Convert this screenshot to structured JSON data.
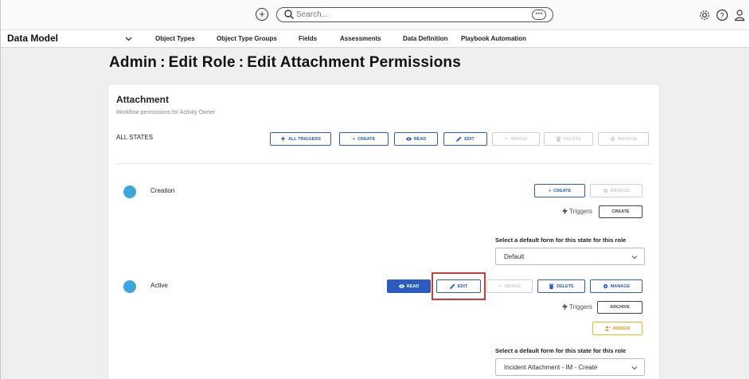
{
  "topbar": {
    "search_placeholder": "Search...",
    "more_label": "•••",
    "add_icon": "plus-circle-icon",
    "icons": [
      "gear-icon",
      "help-icon",
      "user-icon"
    ]
  },
  "nav": {
    "title": "Data Model",
    "items": [
      "Object Types",
      "Object Type Groups",
      "Fields",
      "Assessments",
      "Data Definition",
      "Playbook Automation"
    ]
  },
  "page_title": "Admin : Edit Role : Edit Attachment Permissions",
  "card": {
    "title": "Attachment",
    "subtitle": "Workflow permissions for Activity Owner",
    "all_states_label": "ALL STATES",
    "all_states_buttons": [
      "ALL TRIGGERS",
      "CREATE",
      "READ",
      "EDIT",
      "MERGE",
      "DELETE",
      "MANAGE"
    ]
  },
  "states": {
    "creation": {
      "name": "Creation",
      "buttons": [
        "CREATE",
        "MANAGE"
      ],
      "triggers_label": "Triggers",
      "trigger_button": "CREATE",
      "form_label": "Select a default form for this state for this role",
      "form_value": "Default"
    },
    "active": {
      "name": "Active",
      "buttons": [
        "READ",
        "EDIT",
        "MERGE",
        "DELETE",
        "MANAGE"
      ],
      "triggers_label": "Triggers",
      "trigger_button": "ARCHIVE",
      "assign_button": "ASSIGN",
      "form_label": "Select a default form for this state for this role",
      "form_value": "Incident Attachment - IM - Create"
    }
  },
  "colors": {
    "accent": "#2b5cc2",
    "state_dot": "#3ba7dd",
    "highlight": "#d23a3a",
    "warning": "#f0b429"
  }
}
